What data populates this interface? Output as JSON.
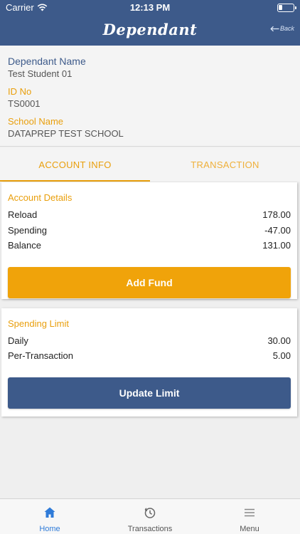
{
  "status_bar": {
    "carrier": "Carrier",
    "time": "12:13 PM"
  },
  "header": {
    "title": "Dependant",
    "back_label": "Back"
  },
  "profile": {
    "name_label": "Dependant Name",
    "name_value": "Test Student 01",
    "id_label": "ID No",
    "id_value": "TS0001",
    "school_label": "School Name",
    "school_value": "DATAPREP TEST SCHOOL"
  },
  "tabs": [
    {
      "label": "ACCOUNT INFO",
      "active": true
    },
    {
      "label": "TRANSACTION",
      "active": false
    }
  ],
  "account_details": {
    "title": "Account Details",
    "rows": [
      {
        "label": "Reload",
        "value": "178.00"
      },
      {
        "label": "Spending",
        "value": "-47.00"
      },
      {
        "label": "Balance",
        "value": "131.00"
      }
    ],
    "button_label": "Add Fund"
  },
  "spending_limit": {
    "title": "Spending Limit",
    "rows": [
      {
        "label": "Daily",
        "value": "30.00"
      },
      {
        "label": "Per-Transaction",
        "value": "5.00"
      }
    ],
    "button_label": "Update Limit"
  },
  "bottom_nav": [
    {
      "label": "Home",
      "icon": "home-icon",
      "active": true
    },
    {
      "label": "Transactions",
      "icon": "history-icon",
      "active": false
    },
    {
      "label": "Menu",
      "icon": "menu-icon",
      "active": false
    }
  ],
  "colors": {
    "primary": "#3d5a8a",
    "accent": "#f0a30a",
    "active_nav": "#2f7bd8"
  }
}
